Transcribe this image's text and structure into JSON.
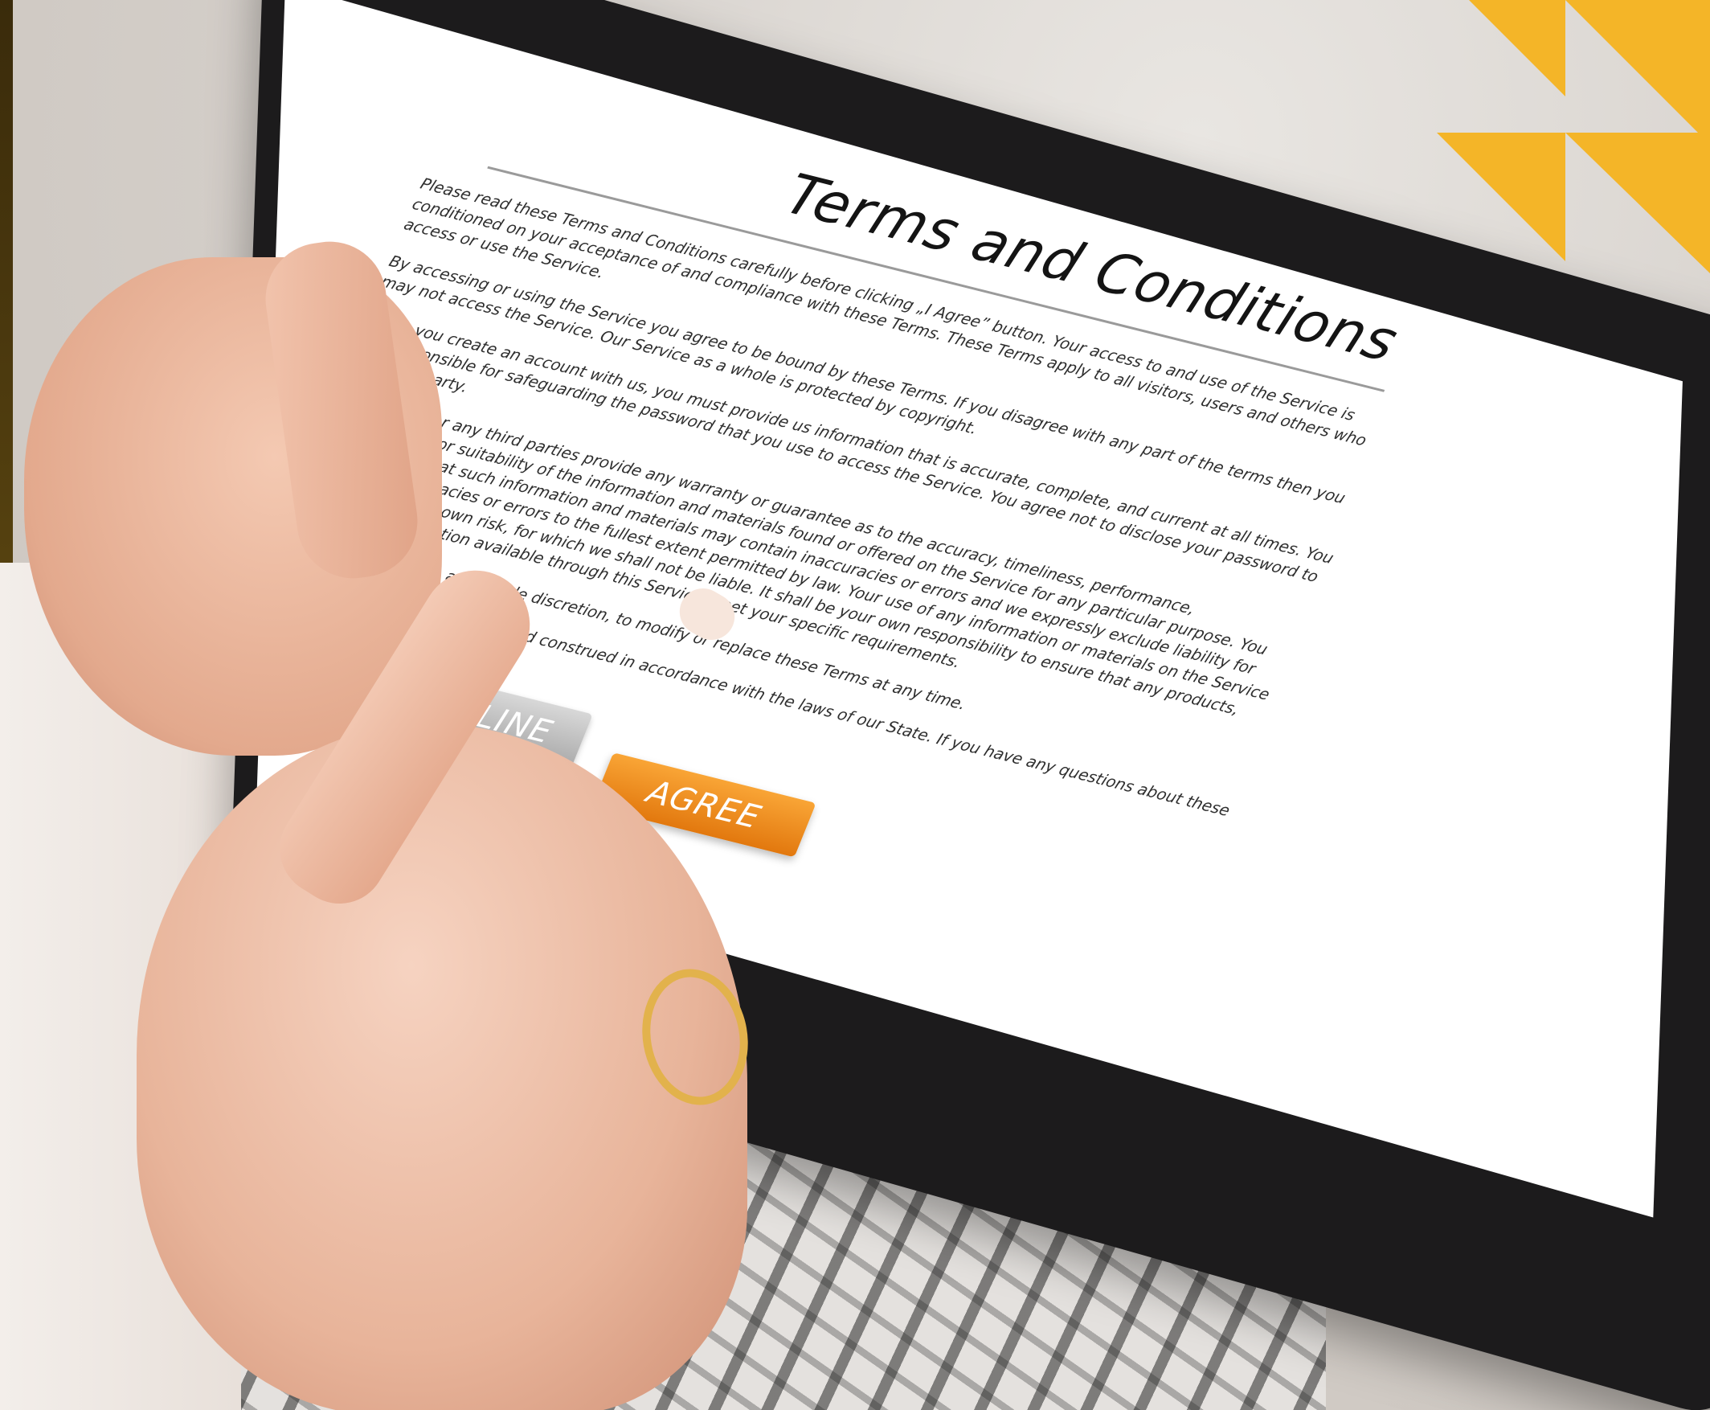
{
  "document": {
    "title": "Terms and Conditions",
    "paragraphs": [
      "Please read these Terms and Conditions carefully before clicking „I Agree” button. Your access to and use of the Service is conditioned on your acceptance of and compliance with these Terms. These Terms apply to all visitors, users and others who access or use the Service.",
      "By accessing or using the Service you agree to be bound by these Terms. If you disagree with any part of the terms then you may not access the Service. Our Service as a whole is protected by copyright.",
      "When you create an account with us, you must provide us information that is accurate, complete, and current at all times. You are responsible for safeguarding the password that you use to access the Service. You agree not to disclose your password to any third party.",
      "Neither we nor any third parties provide any warranty or guarantee as to the accuracy, timeliness, performance, completeness or suitability of the information and materials found or offered on the Service for any particular purpose. You acknowledge that such information and materials may contain inaccuracies or errors and we expressly exclude liability for any such inaccuracies or errors to the fullest extent permitted by law. Your use of any information or materials on the Service is entirely at your own risk, for which we shall not be liable. It shall be your own responsibility to ensure that any products, services or information available through this Service meet your specific requirements.",
      "We reserve the right, at our sole discretion, to modify or replace these Terms at any time.",
      "These Terms shall be governed and construed in accordance with the laws of our State. If you have any questions about these Terms, please contact us."
    ]
  },
  "buttons": {
    "decline": "DECLINE",
    "agree": "AGREE"
  },
  "colors": {
    "accent": "#F4B528",
    "agree": "#EE8A1E",
    "decline": "#BDBDBD",
    "bezel": "#1C1B1C"
  }
}
